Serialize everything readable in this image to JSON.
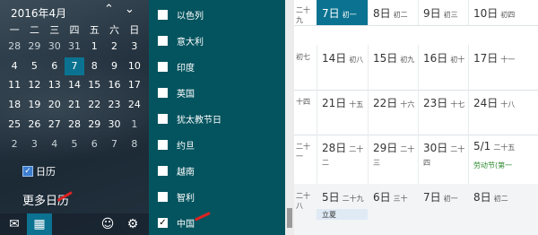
{
  "mini_calendar": {
    "month_title": "2016年4月",
    "weekdays": [
      "一",
      "二",
      "三",
      "四",
      "五",
      "六",
      "日"
    ],
    "weeks": [
      [
        "28",
        "29",
        "30",
        "31",
        "1",
        "2",
        "3"
      ],
      [
        "4",
        "5",
        "6",
        "7",
        "8",
        "9",
        "10"
      ],
      [
        "11",
        "12",
        "13",
        "14",
        "15",
        "16",
        "17"
      ],
      [
        "18",
        "19",
        "20",
        "21",
        "22",
        "23",
        "24"
      ],
      [
        "25",
        "26",
        "27",
        "28",
        "29",
        "30",
        "1"
      ],
      [
        "2",
        "3",
        "4",
        "5",
        "6",
        "7",
        "8"
      ]
    ],
    "calendars_label": "日历",
    "more_calendars": "更多日历"
  },
  "holidays": [
    "以色列",
    "意大利",
    "印度",
    "英国",
    "犹太教节日",
    "约旦",
    "越南",
    "智利",
    "中国"
  ],
  "week_grid": {
    "rows": [
      [
        {
          "d": "二十九"
        },
        {
          "d": "7日",
          "l": "初一",
          "sel": true
        },
        {
          "d": "8日",
          "l": "初二"
        },
        {
          "d": "9日",
          "l": "初三"
        },
        {
          "d": "10日",
          "l": "初四"
        }
      ],
      [
        {
          "d": "初七"
        },
        {
          "d": "14日",
          "l": "初八"
        },
        {
          "d": "15日",
          "l": "初九"
        },
        {
          "d": "16日",
          "l": "初十"
        },
        {
          "d": "17日",
          "l": "十一"
        }
      ],
      [
        {
          "d": "十四"
        },
        {
          "d": "21日",
          "l": "十五"
        },
        {
          "d": "22日",
          "l": "十六"
        },
        {
          "d": "23日",
          "l": "十七"
        },
        {
          "d": "24日",
          "l": "十八"
        }
      ],
      [
        {
          "d": "二十一"
        },
        {
          "d": "28日",
          "l": "二十二"
        },
        {
          "d": "29日",
          "l": "二十三"
        },
        {
          "d": "30日",
          "l": "二十四"
        },
        {
          "d": "5/1",
          "l": "二十五",
          "tag": "劳动节(第一"
        }
      ],
      [
        {
          "d": "二十八"
        },
        {
          "d": "5日",
          "l": "二十九",
          "tag": "立夏",
          "tagbg": true
        },
        {
          "d": "6日",
          "l": "三十"
        },
        {
          "d": "7日",
          "l": "初一"
        },
        {
          "d": "8日",
          "l": "初二"
        }
      ]
    ]
  },
  "colors": {
    "accent": "#0b7391",
    "holiday_panel": "#04545f",
    "annotation_arrow": "#dd2222"
  },
  "icons": {
    "nav_up": "chevron-up-icon",
    "nav_down": "chevron-down-icon",
    "mail": "mail-icon",
    "calendar": "calendar-icon",
    "people": "smiley-icon",
    "settings": "gear-icon"
  }
}
